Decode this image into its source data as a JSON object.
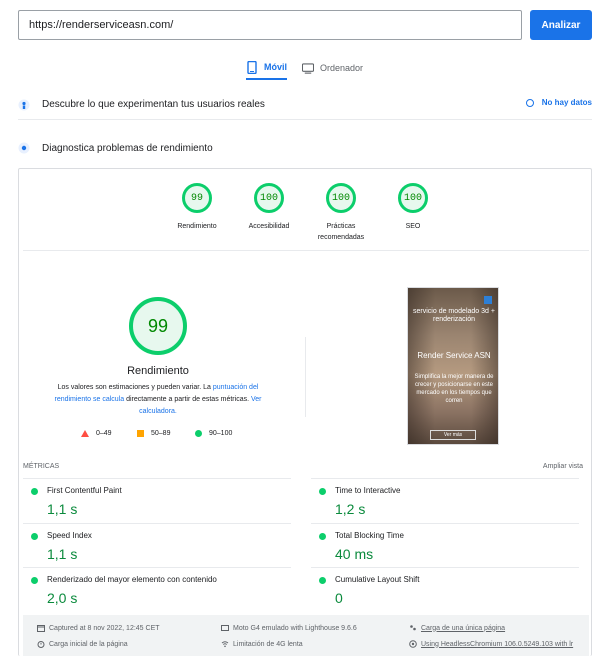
{
  "url_bar": {
    "value": "https://renderserviceasn.com/",
    "analyze_label": "Analizar"
  },
  "device_tabs": [
    {
      "label": "Móvil",
      "active": true,
      "icon": "mobile-icon"
    },
    {
      "label": "Ordenador",
      "active": false,
      "icon": "desktop-icon"
    }
  ],
  "field_section": {
    "title": "Descubre lo que experimentan tus usuarios reales",
    "nodata_label": "No hay datos"
  },
  "lab_section": {
    "title": "Diagnostica problemas de rendimiento"
  },
  "categories": [
    {
      "score": "99",
      "label": "Rendimiento"
    },
    {
      "score": "100",
      "label": "Accesibilidad"
    },
    {
      "score": "100",
      "label": "Prácticas recomendadas"
    },
    {
      "score": "100",
      "label": "SEO"
    }
  ],
  "performance": {
    "score": "99",
    "title": "Rendimiento",
    "desc_part1": "Los valores son estimaciones y pueden variar. La ",
    "desc_link1": "puntuación del rendimiento se calcula",
    "desc_part2": " directamente a partir de estas métricas. ",
    "desc_link2": "Ver calculadora.",
    "legend": [
      "0–49",
      "50–89",
      "90–100"
    ]
  },
  "thumbnail": {
    "heading": "servicio de modelado 3d + renderización",
    "brand": "Render Service ASN",
    "tagline": "Simplifica la mejor manera de crecer y posicionarse en este mercado en los tiempos que corren",
    "button": "Ver más"
  },
  "metrics": {
    "header": "MÉTRICAS",
    "expand_label": "Ampliar vista",
    "items": [
      {
        "name": "First Contentful Paint",
        "value": "1,1 s"
      },
      {
        "name": "Time to Interactive",
        "value": "1,2 s"
      },
      {
        "name": "Speed Index",
        "value": "1,1 s"
      },
      {
        "name": "Total Blocking Time",
        "value": "40 ms"
      },
      {
        "name": "Renderizado del mayor elemento con contenido",
        "value": "2,0 s"
      },
      {
        "name": "Cumulative Layout Shift",
        "value": "0"
      }
    ]
  },
  "footer": {
    "captured": "Captured at 8 nov 2022, 12:45 CET",
    "initial_load": "Carga inicial de la página",
    "device": "Moto G4 emulado with Lighthouse 9.6.6",
    "throttling": "Limitación de 4G lenta",
    "single_load": "Carga de una única página",
    "browser": "Using HeadlessChromium 106.0.5249.103 with lr"
  },
  "colors": {
    "accent": "#1a73e8",
    "pass": "#0cce6b",
    "average": "#ffa400",
    "fail": "#ff4e42"
  }
}
